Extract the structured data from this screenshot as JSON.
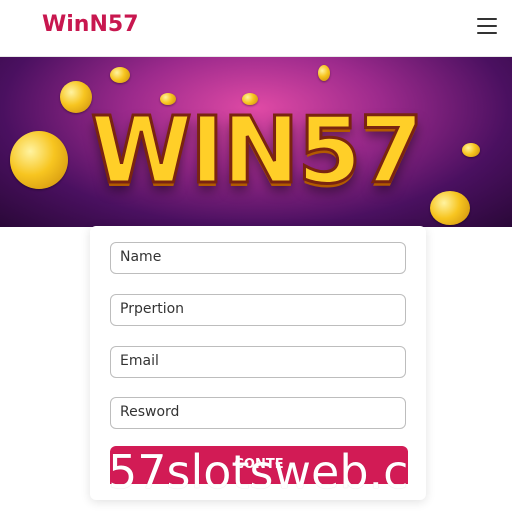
{
  "header": {
    "logo_text": "WinN57",
    "menu_icon": "hamburger-menu-icon"
  },
  "banner": {
    "headline": "WIN57"
  },
  "form": {
    "fields": [
      {
        "placeholder": "Name"
      },
      {
        "placeholder": "Prpertion"
      },
      {
        "placeholder": "Email"
      },
      {
        "placeholder": "Resword"
      }
    ],
    "submit_label": "CONTE"
  },
  "watermark": "57slotsweb.c",
  "colors": {
    "brand": "#c8174f",
    "button": "#d21b55",
    "banner_gold": "#ffcf28"
  }
}
